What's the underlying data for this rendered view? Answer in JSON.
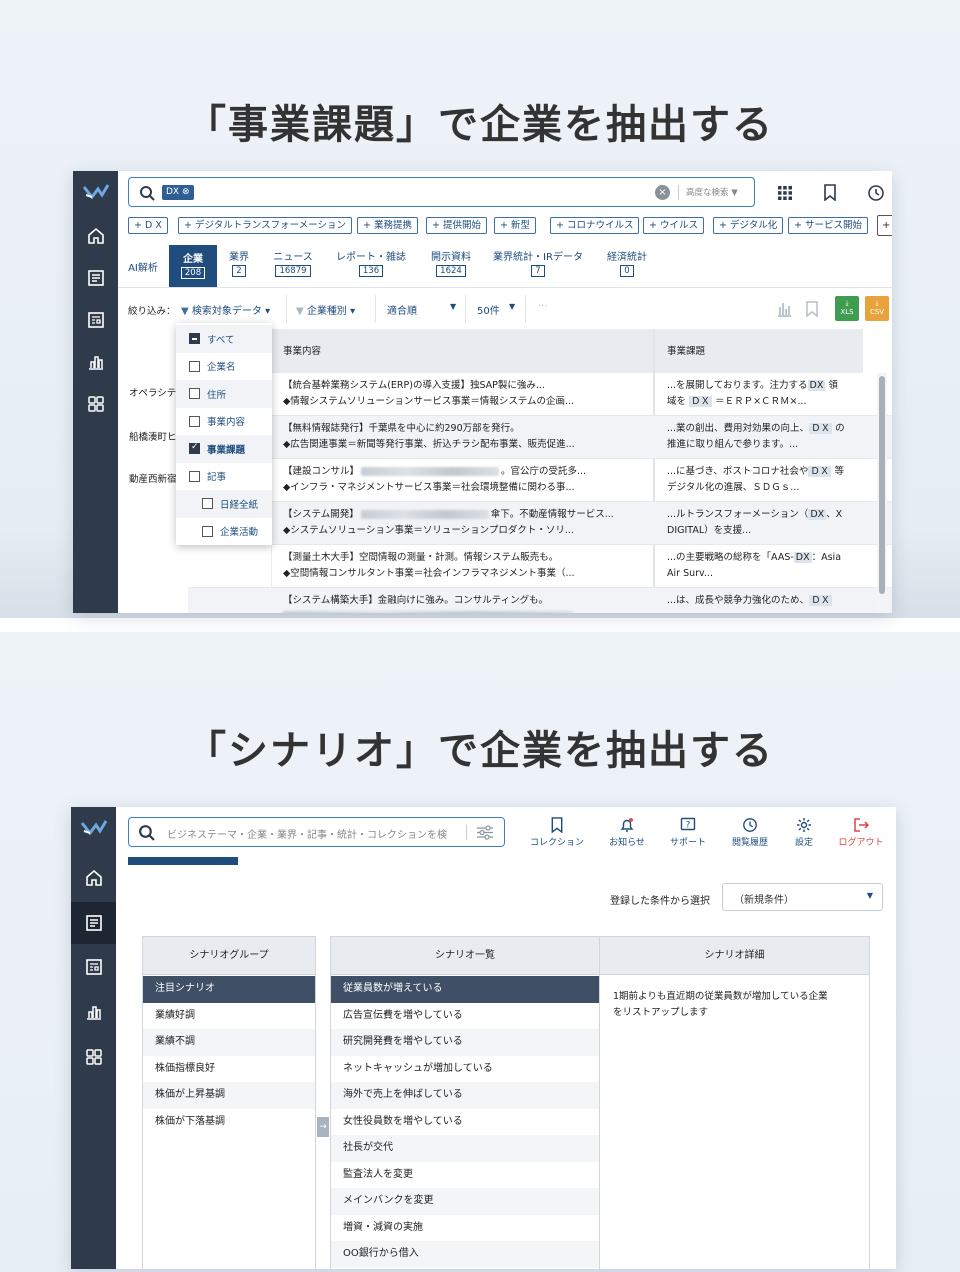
{
  "section1": {
    "heading": "「事業課題」で企業を抽出する"
  },
  "section2": {
    "heading": "「シナリオ」で企業を抽出する"
  },
  "colors": {
    "navy": "#1f4d7d",
    "sidebar": "#2f3a4b",
    "accent_blue": "#3b7fc4",
    "xls_green": "#3f9d4f",
    "csv_orange": "#e8a33a"
  },
  "search1": {
    "token": "DX",
    "advanced_label": "高度な検索 ▼"
  },
  "chips": [
    "+ D X",
    "+ デジタルトランスフォーメーション",
    "+ 業務提携",
    "+ 提供開始",
    "+ 新型",
    "+ コロナウイルス",
    "+ ウイルス",
    "+ デジタル化",
    "+ サービス開始"
  ],
  "tabs": [
    {
      "label": "AI解析",
      "count": ""
    },
    {
      "label": "企業",
      "count": "208"
    },
    {
      "label": "業界",
      "count": "2"
    },
    {
      "label": "ニュース",
      "count": "16879"
    },
    {
      "label": "レポート・雑誌",
      "count": "136"
    },
    {
      "label": "開示資料",
      "count": "1624"
    },
    {
      "label": "業界統計・IRデータ",
      "count": "7"
    },
    {
      "label": "経済統計",
      "count": "0"
    }
  ],
  "filter": {
    "label": "絞り込み：",
    "target": "検索対象データ ▾",
    "type": "企業種別 ▾",
    "sort": "適合順",
    "sort_arrow": "▼",
    "count": "50件",
    "count_arrow": "▼",
    "more": "···",
    "xls": "XLS",
    "csv": "CSV"
  },
  "table": {
    "headers": {
      "content": "事業内容",
      "issue": "事業課題"
    },
    "left_names": [
      "オペラシテ",
      "船橋湊町ヒ",
      "動産西新宿"
    ],
    "rows": [
      {
        "c1a": "【統合基幹業務システム(ERP)の導入支援】独SAP製に強み...",
        "c1b": "◆情報システムソリューションサービス事業＝情報システムの企画...",
        "i1a": "...を展開しております。注力する",
        "i1k": "DX",
        "i1c": " 領",
        "i2a": "域を ",
        "i2k": "ＤＸ",
        "i2c": " ＝ＥＲＰ×ＣＲＭ×..."
      },
      {
        "c1a": "【無料情報誌発行】千葉県を中心に約290万部を発行。",
        "c1b": "◆広告関連事業＝新聞等発行事業、折込チラシ配布事業、販売促進...",
        "i1a": "...業の創出、費用対効果の向上、",
        "i1k": "ＤＸ",
        "i1c": " の",
        "i2a": "推進に取り組んで参ります。...",
        "i2k": "",
        "i2c": ""
      },
      {
        "c1a": "【建設コンサル】",
        "c1m": "。官公庁の受託多...",
        "c1b": "◆インフラ・マネジメントサービス事業＝社会環境整備に関わる事...",
        "i1a": "...に基づき、ポストコロナ社会や",
        "i1k": "ＤＸ",
        "i1c": " 等",
        "i2a": "デジタル化の進展、ＳＤＧｓ...",
        "i2k": "",
        "i2c": ""
      },
      {
        "c1a": "【システム開発】",
        "c1m": "傘下。不動産情報サービス...",
        "c1b": "◆システムソリューション事業＝ソリューションプロダクト・ソリ...",
        "i1a": "...ルトランスフォーメーション（",
        "i1k": "DX",
        "i1c": "、X",
        "i2a": "DIGITAL）を支援...",
        "i2k": "",
        "i2c": ""
      },
      {
        "c1a": "【測量土木大手】空間情報の測量・計測。情報システム販売も。",
        "c1b": "◆空間情報コンサルタント事業＝社会インフラマネジメント事業（...",
        "i1a": "...の主要戦略の総称を「AAS-",
        "i1k": "DX",
        "i1c": "：Asia",
        "i2a": "Air Surv...",
        "i2k": "",
        "i2c": ""
      },
      {
        "c1a": "【システム構築大手】金融向けに強み。コンサルティングも。",
        "c1b": "",
        "i1a": "...は、成長や競争力強化のため、",
        "i1k": "ＤＸ",
        "i1c": "",
        "i2a": "",
        "i2k": "",
        "i2c": ""
      }
    ]
  },
  "dropdown": [
    {
      "label": "すべて",
      "state": "minus"
    },
    {
      "label": "企業名",
      "state": "off"
    },
    {
      "label": "住所",
      "state": "off"
    },
    {
      "label": "事業内容",
      "state": "off"
    },
    {
      "label": "事業課題",
      "state": "checked"
    },
    {
      "label": "記事",
      "state": "off"
    },
    {
      "label": "日経全紙",
      "state": "off"
    },
    {
      "label": "企業活動",
      "state": "off"
    }
  ],
  "search2": {
    "placeholder": "ビジネステーマ・企業・業界・記事・統計・コレクションを検"
  },
  "toolbar": [
    {
      "label": "コレクション",
      "icon": "bookmark-icon"
    },
    {
      "label": "お知らせ",
      "icon": "bell-icon"
    },
    {
      "label": "サポート",
      "icon": "help-icon"
    },
    {
      "label": "閲覧履歴",
      "icon": "history-icon"
    },
    {
      "label": "設定",
      "icon": "gear-icon"
    },
    {
      "label": "ログアウト",
      "icon": "logout-icon"
    }
  ],
  "saved": {
    "label": "登録した条件から選択",
    "value": "（新規条件）"
  },
  "groups": {
    "title": "シナリオグループ",
    "items": [
      "注目シナリオ",
      "業績好調",
      "業績不調",
      "株価指標良好",
      "株価が上昇基調",
      "株価が下落基調"
    ]
  },
  "scenarios": {
    "title": "シナリオ一覧",
    "items": [
      "従業員数が増えている",
      "広告宣伝費を増やしている",
      "研究開発費を増やしている",
      "ネットキャッシュが増加している",
      "海外で売上を伸ばしている",
      "女性役員数を増やしている",
      "社長が交代",
      "監査法人を変更",
      "メインバンクを変更",
      "増資・減資の実施",
      "OO銀行から借入"
    ]
  },
  "detail": {
    "title": "シナリオ詳細",
    "line1": "1期前よりも直近期の従業員数が増加している企業",
    "line2": "をリストアップします"
  }
}
